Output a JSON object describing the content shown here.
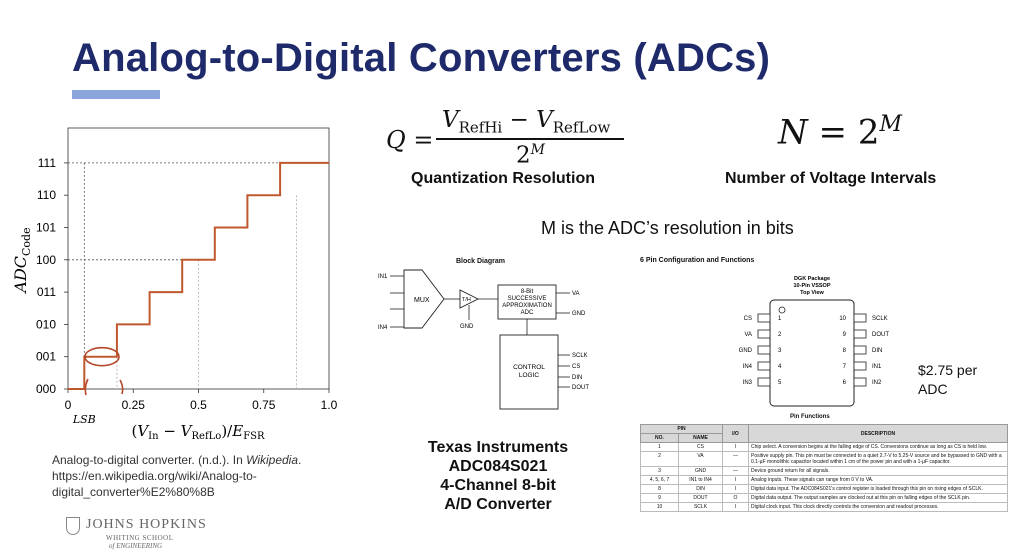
{
  "slide": {
    "title": "Analog-to-Digital Converters (ADCs)",
    "title_color": "#1f2a6b",
    "accent_color": "#8aa6dd"
  },
  "equations": {
    "q_lhs": "Q =",
    "q_numerator": "V_RefHi − V_RefLow",
    "q_denominator": "2^M",
    "q_label": "Quantization Resolution",
    "n_equation": "N = 2^M",
    "n_label": "Number of Voltage Intervals",
    "m_statement": "M is the ADC’s resolution in bits"
  },
  "staircase_chart": {
    "ylabel": "ADC_Code",
    "xlabel": "(V_In − V_RefLo)/E_FSR",
    "x_ticks": [
      "0",
      "0.25",
      "0.5",
      "0.75",
      "1.0"
    ],
    "y_ticks": [
      "000",
      "001",
      "010",
      "011",
      "100",
      "101",
      "110",
      "111"
    ],
    "lsb_label": "LSB",
    "line_color": "#c0582e"
  },
  "chart_data": {
    "type": "line",
    "title": "",
    "xlabel": "(V_In − V_RefLo)/E_FSR",
    "ylabel": "ADC_Code",
    "xlim": [
      0,
      1.0
    ],
    "y_categories": [
      "000",
      "001",
      "010",
      "011",
      "100",
      "101",
      "110",
      "111"
    ],
    "series": [
      {
        "x": [
          0,
          0.0625,
          0.0625,
          0.1875,
          0.1875,
          0.3125,
          0.3125,
          0.4375,
          0.4375,
          0.5625,
          0.5625,
          0.6875,
          0.6875,
          0.8125,
          0.8125,
          1.0
        ],
        "values": [
          0,
          0,
          1,
          1,
          2,
          2,
          3,
          3,
          4,
          4,
          5,
          5,
          6,
          6,
          7,
          7
        ]
      }
    ],
    "grid": false
  },
  "citation": {
    "line1": "Analog-to-digital converter. (n.d.). In ",
    "line1_italic": "Wikipedia",
    "line1_end": ".",
    "line2": "https://en.wikipedia.org/wiki/Analog-to-",
    "line3": "digital_converter%E2%80%8B"
  },
  "logo": {
    "name": "JOHNS HOPKINS",
    "sub1": "WHITING SCHOOL",
    "sub2": "of ENGINEERING"
  },
  "block_diagram": {
    "title": "Block Diagram",
    "in1": "IN1",
    "in4": "IN4",
    "mux": "MUX",
    "th": "T/H",
    "sar_lines": [
      "8-Bit",
      "SUCCESSIVE",
      "APPROXIMATION",
      "ADC"
    ],
    "va": "VA",
    "gnd": "GND",
    "gnd_bottom": "GND",
    "control": [
      "CONTROL",
      "LOGIC"
    ],
    "pins": [
      "SCLK",
      "CS",
      "DIN",
      "DOUT"
    ]
  },
  "ti_label": [
    "Texas Instruments",
    "ADC084S021",
    "4-Channel 8-bit",
    "A/D Converter"
  ],
  "pin_config": {
    "title": "6   Pin Configuration and Functions",
    "package_lines": [
      "DGK Package",
      "10-Pin VSSOP",
      "Top View"
    ],
    "left_pins": [
      {
        "name": "CS",
        "num": "1"
      },
      {
        "name": "VA",
        "num": "2"
      },
      {
        "name": "GND",
        "num": "3"
      },
      {
        "name": "IN4",
        "num": "4"
      },
      {
        "name": "IN3",
        "num": "5"
      }
    ],
    "right_pins": [
      {
        "name": "SCLK",
        "num": "10"
      },
      {
        "name": "DOUT",
        "num": "9"
      },
      {
        "name": "DIN",
        "num": "8"
      },
      {
        "name": "IN1",
        "num": "7"
      },
      {
        "name": "IN2",
        "num": "6"
      }
    ]
  },
  "price": [
    "$2.75 per",
    "ADC"
  ],
  "pin_functions": {
    "title": "Pin Functions",
    "headers": [
      "NO.",
      "NAME",
      "I/O",
      "DESCRIPTION"
    ],
    "group_header": "PIN",
    "rows": [
      [
        "1",
        "CS",
        "I",
        "Chip select. A conversion begins at the falling edge of CS. Conversions continue as long as CS is held low."
      ],
      [
        "2",
        "VA",
        "—",
        "Positive supply pin. This pin must be connected to a quiet 2.7-V to 5.25-V source and be bypassed to GND with a 0.1-µF monolithic capacitor located within 1 cm of the power pin and with a 1-µF capacitor."
      ],
      [
        "3",
        "GND",
        "—",
        "Device ground return for all signals."
      ],
      [
        "4, 5, 6, 7",
        "IN1 to IN4",
        "I",
        "Analog inputs. These signals can range from 0 V to VA."
      ],
      [
        "8",
        "DIN",
        "I",
        "Digital data input. The ADC084S021's control register is loaded through this pin on rising edges of SCLK."
      ],
      [
        "9",
        "DOUT",
        "O",
        "Digital data output. The output samples are clocked out at this pin on falling edges of the SCLK pin."
      ],
      [
        "10",
        "SCLK",
        "I",
        "Digital clock input. This clock directly controls the conversion and readout processes."
      ]
    ]
  }
}
